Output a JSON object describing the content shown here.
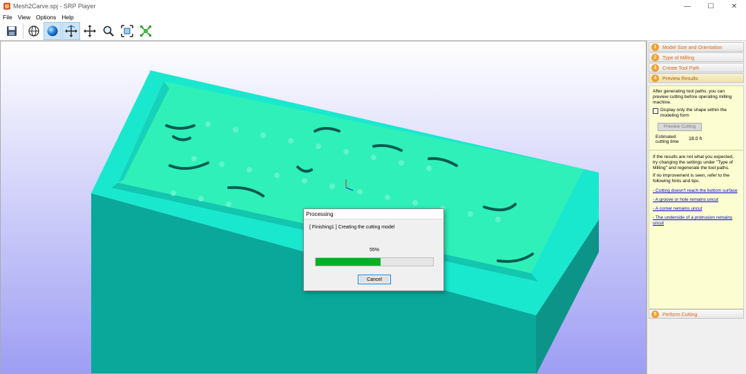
{
  "window": {
    "title": "Mesh2Carve.spj - SRP Player",
    "controls": {
      "minimize": "—",
      "maximize": "☐",
      "close": "✕"
    }
  },
  "menu": [
    "File",
    "View",
    "Options",
    "Help"
  ],
  "toolbar": {
    "buttons": [
      {
        "icon": "save-icon"
      },
      {
        "icon": "globe-wireframe-icon"
      },
      {
        "icon": "shaded-sphere-icon",
        "active": true
      },
      {
        "icon": "rotate-arrows-icon",
        "active": true
      },
      {
        "icon": "move-arrows-icon"
      },
      {
        "icon": "zoom-icon"
      },
      {
        "icon": "fit-view-icon"
      },
      {
        "icon": "zoom-extents-icon"
      }
    ]
  },
  "panel": {
    "steps": [
      {
        "number": "1",
        "label": "Model Size and Orientation"
      },
      {
        "number": "2",
        "label": "Type of Milling"
      },
      {
        "number": "3",
        "label": "Create Tool Path"
      },
      {
        "number": "4",
        "label": "Preview Results"
      },
      {
        "number": "5",
        "label": "Perform Cutting"
      }
    ],
    "intro": "After generating tool paths, you can preview cutting before operating milling machine.",
    "checkbox_label": "Display only the shape within the modeling form",
    "preview_button": "Preview Cutting",
    "estimated_label": "Estimated cutting time",
    "estimated_value": "18.0  h",
    "hint1": "If the results are not what you expected, try changing the settings under \"Type of Milling\" and regenerate the tool paths.",
    "hint2": "If no improvement is seen, refer to the following hints and tips.",
    "links": [
      "- Cutting doesn't reach the bottom surface",
      "- A groove or hole remains uncut",
      "- A corner remains uncut",
      "- The underside of a protrusion remains uncut"
    ]
  },
  "dialog": {
    "title": "Processing",
    "status": "[ Finishing1 ]  Creating the cutting model",
    "percent_text": "55%",
    "progress": 0.55,
    "cancel": "Cancel"
  },
  "colors": {
    "model_top": "#19e8cf",
    "model_inner": "#2ff0b8",
    "model_side": "#0aa89a",
    "background_top": "#ffffff",
    "background_bottom": "#9d9df4",
    "progress": "#06b025",
    "accent_orange": "#f0a030"
  }
}
